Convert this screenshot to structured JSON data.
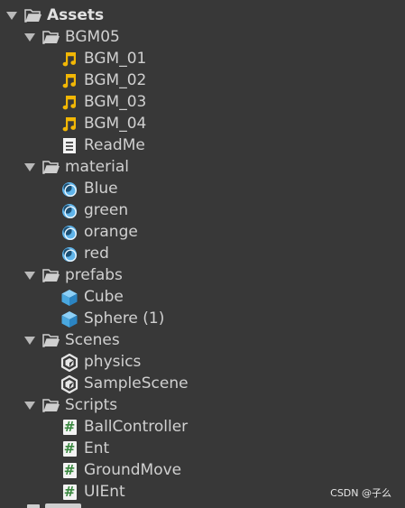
{
  "project_tree": {
    "root": {
      "label": "Assets",
      "icon": "open-folder-icon",
      "expanded": true
    },
    "folders": [
      {
        "label": "BGM05",
        "icon": "open-folder-icon",
        "expanded": true,
        "items": [
          {
            "label": "BGM_01",
            "icon": "audio-clip-icon"
          },
          {
            "label": "BGM_02",
            "icon": "audio-clip-icon"
          },
          {
            "label": "BGM_03",
            "icon": "audio-clip-icon"
          },
          {
            "label": "BGM_04",
            "icon": "audio-clip-icon"
          },
          {
            "label": "ReadMe",
            "icon": "text-document-icon"
          }
        ]
      },
      {
        "label": "material",
        "icon": "open-folder-icon",
        "expanded": true,
        "items": [
          {
            "label": "Blue",
            "icon": "material-sphere-icon"
          },
          {
            "label": "green",
            "icon": "material-sphere-icon"
          },
          {
            "label": "orange",
            "icon": "material-sphere-icon"
          },
          {
            "label": "red",
            "icon": "material-sphere-icon"
          }
        ]
      },
      {
        "label": "prefabs",
        "icon": "open-folder-icon",
        "expanded": true,
        "items": [
          {
            "label": "Cube",
            "icon": "prefab-cube-icon"
          },
          {
            "label": "Sphere (1)",
            "icon": "prefab-cube-icon"
          }
        ]
      },
      {
        "label": "Scenes",
        "icon": "open-folder-icon",
        "expanded": true,
        "items": [
          {
            "label": "physics",
            "icon": "unity-scene-icon"
          },
          {
            "label": "SampleScene",
            "icon": "unity-scene-icon"
          }
        ]
      },
      {
        "label": "Scripts",
        "icon": "open-folder-icon",
        "expanded": true,
        "items": [
          {
            "label": "BallController",
            "icon": "csharp-script-icon"
          },
          {
            "label": "Ent",
            "icon": "csharp-script-icon"
          },
          {
            "label": "GroundMove",
            "icon": "csharp-script-icon"
          },
          {
            "label": "UIEnt",
            "icon": "csharp-script-icon"
          }
        ]
      }
    ],
    "colors": {
      "background": "#383838",
      "text": "#d0d0d0",
      "caret": "#b9b9b9",
      "audio": "#f2b705",
      "material": "#5fb4ea",
      "prefab": "#4aa8e0",
      "script_hash": "#39883f"
    }
  },
  "watermark": "CSDN @子么"
}
